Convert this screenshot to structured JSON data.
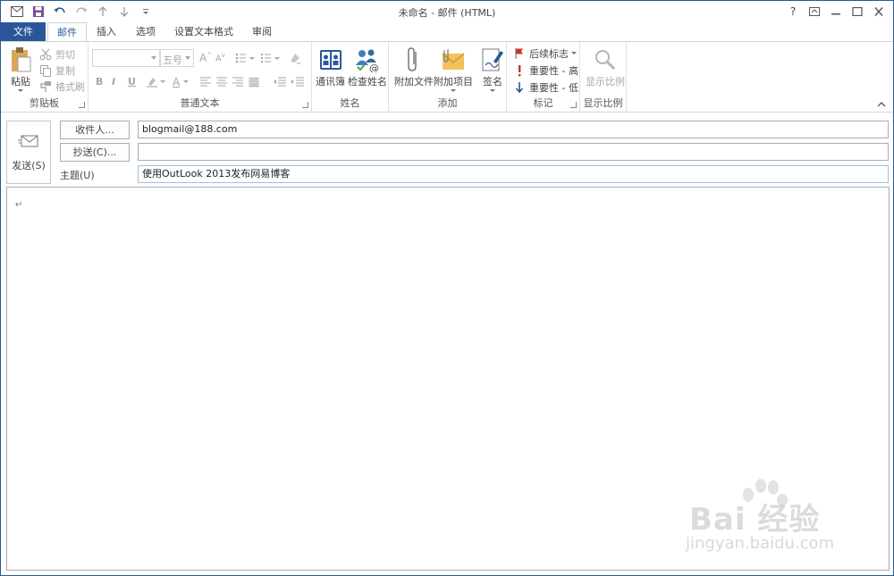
{
  "window": {
    "title": "未命名 - 邮件 (HTML)"
  },
  "qat": {
    "icons": [
      "outlook-icon",
      "save-icon",
      "undo-icon",
      "redo-icon",
      "up-icon",
      "down-icon",
      "customize-icon"
    ]
  },
  "controls": {
    "help": "?",
    "restore_ribbon": "ribbon-display-icon",
    "minimize": "minimize-icon",
    "maximize": "maximize-icon",
    "close": "close-icon"
  },
  "tabs": {
    "file": "文件",
    "mail": "邮件",
    "insert": "插入",
    "options": "选项",
    "format": "设置文本格式",
    "review": "审阅"
  },
  "ribbon": {
    "clipboard": {
      "label": "剪贴板",
      "paste": "粘贴",
      "cut": "剪切",
      "copy": "复制",
      "format_painter": "格式刷"
    },
    "basic_text": {
      "label": "普通文本",
      "font_size": "五号",
      "bold": "B",
      "italic": "I",
      "underline": "U"
    },
    "names": {
      "label": "姓名",
      "address_book": "通讯簿",
      "check_names": "检查姓名"
    },
    "include": {
      "label": "添加",
      "attach_file": "附加文件",
      "attach_item": "附加项目",
      "signature": "签名"
    },
    "tags": {
      "label": "标记",
      "follow_up": "后续标志",
      "high": "重要性 - 高",
      "low": "重要性 - 低"
    },
    "zoom": {
      "label": "显示比例",
      "zoom": "显示比例"
    }
  },
  "header": {
    "send": "发送(S)",
    "to_button": "收件人...",
    "to_value": "blogmail@188.com",
    "cc_button": "抄送(C)...",
    "cc_value": "",
    "subject_label": "主题(U)",
    "subject_value": "使用OutLook 2013发布网易博客"
  },
  "body": {
    "paragraph_mark": "↵"
  },
  "watermark": {
    "text": "Bai 经验",
    "sub": "jingyan.baidu.com"
  },
  "colors": {
    "accent": "#2b579a",
    "flag_red": "#c0392b",
    "low_blue": "#2b579a"
  }
}
